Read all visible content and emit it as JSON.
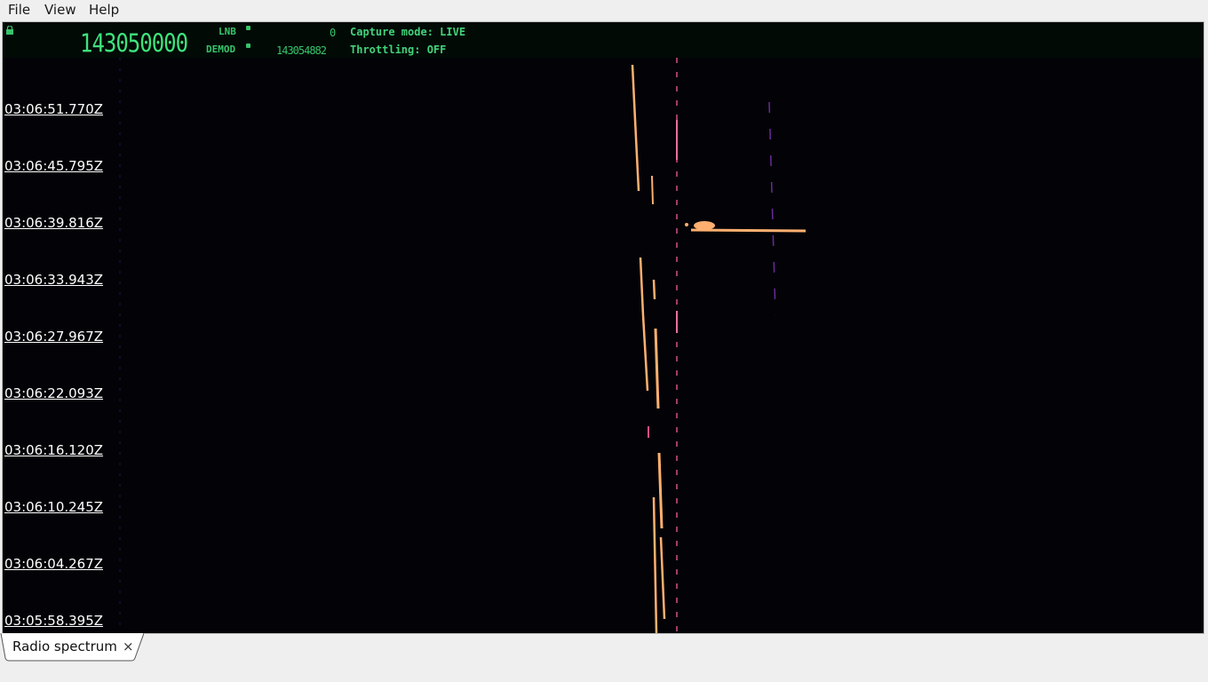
{
  "menu": {
    "file": "File",
    "view": "View",
    "help": "Help"
  },
  "header": {
    "main_frequency": "143050000",
    "lnb_label": "LNB",
    "lnb_value": "0",
    "demod_label": "DEMOD",
    "demod_value": "143054882",
    "capture_mode": "Capture mode: LIVE",
    "throttling": "Throttling: OFF"
  },
  "waterfall": {
    "timestamps": [
      "03:06:51.770Z",
      "03:06:45.795Z",
      "03:06:39.816Z",
      "03:06:33.943Z",
      "03:06:27.967Z",
      "03:06:22.093Z",
      "03:06:16.120Z",
      "03:06:10.245Z",
      "03:06:04.267Z",
      "03:05:58.395Z"
    ]
  },
  "tabs": {
    "active_label": "Radio spectrum",
    "close_symbol": "×"
  },
  "colors": {
    "background": "#030307",
    "display_green": "#3ee27c",
    "signal_hot": "#ffb070",
    "signal_mid": "#d4508a",
    "signal_low": "#5a2a8c"
  }
}
